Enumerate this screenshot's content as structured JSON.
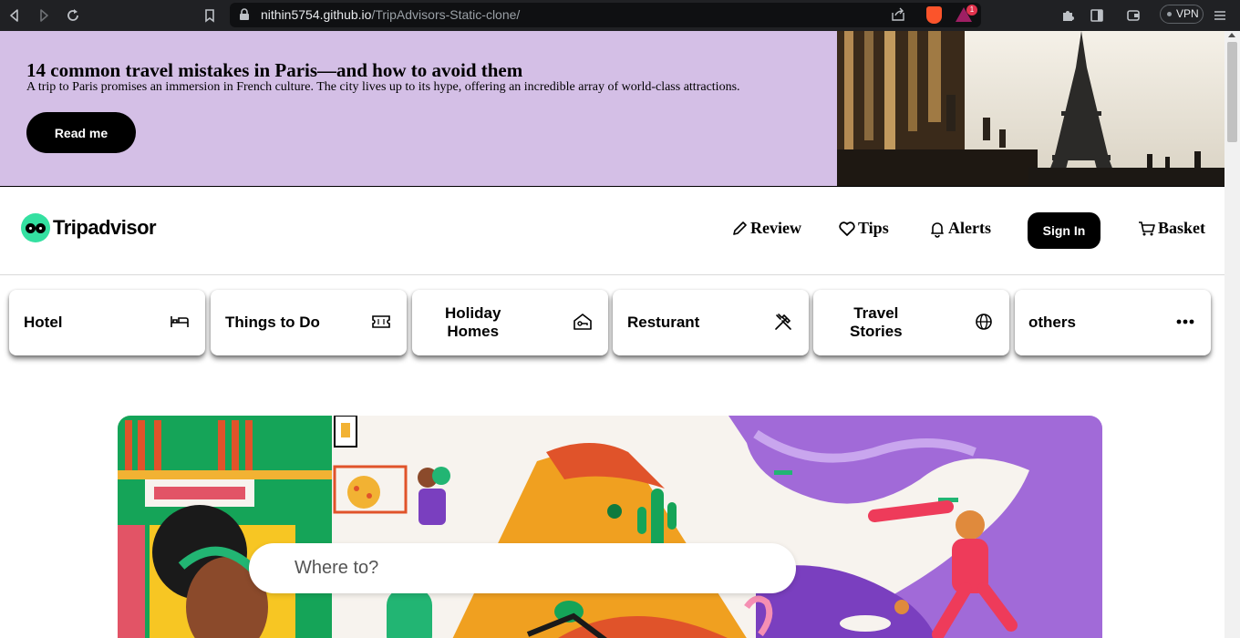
{
  "browser": {
    "url_host": "nithin5754.github.io",
    "url_path": "/TripAdvisors-Static-clone/",
    "vpn_label": "VPN",
    "badge_count": "1"
  },
  "banner": {
    "title": "14 common travel mistakes in Paris—and how to avoid them",
    "description": "A trip to Paris promises an immersion in French culture. The city lives up to its hype, offering an incredible array of world-class attractions.",
    "button_label": "Read me",
    "bg_color": "#d4bfe6"
  },
  "header": {
    "logo_text": "Tripadvisor",
    "nav": [
      {
        "label": "Review",
        "icon": "pencil-icon"
      },
      {
        "label": "Tips",
        "icon": "heart-icon"
      },
      {
        "label": "Alerts",
        "icon": "bell-icon"
      }
    ],
    "signin_label": "Sign In",
    "basket_label": "Basket"
  },
  "categories": [
    {
      "label": "Hotel",
      "icon": "bed-icon"
    },
    {
      "label": "Things to Do",
      "icon": "ticket-icon"
    },
    {
      "label_line1": "Holiday",
      "label_line2": "Homes",
      "icon": "home-key-icon"
    },
    {
      "label": "Resturant",
      "icon": "fork-knife-icon"
    },
    {
      "label_line1": "Travel",
      "label_line2": "Stories",
      "icon": "globe-icon"
    },
    {
      "label": "others",
      "icon": "more-dots-icon"
    }
  ],
  "hero": {
    "search_placeholder": "Where to?"
  },
  "colors": {
    "brand_green": "#34e0a1",
    "black": "#000000"
  }
}
